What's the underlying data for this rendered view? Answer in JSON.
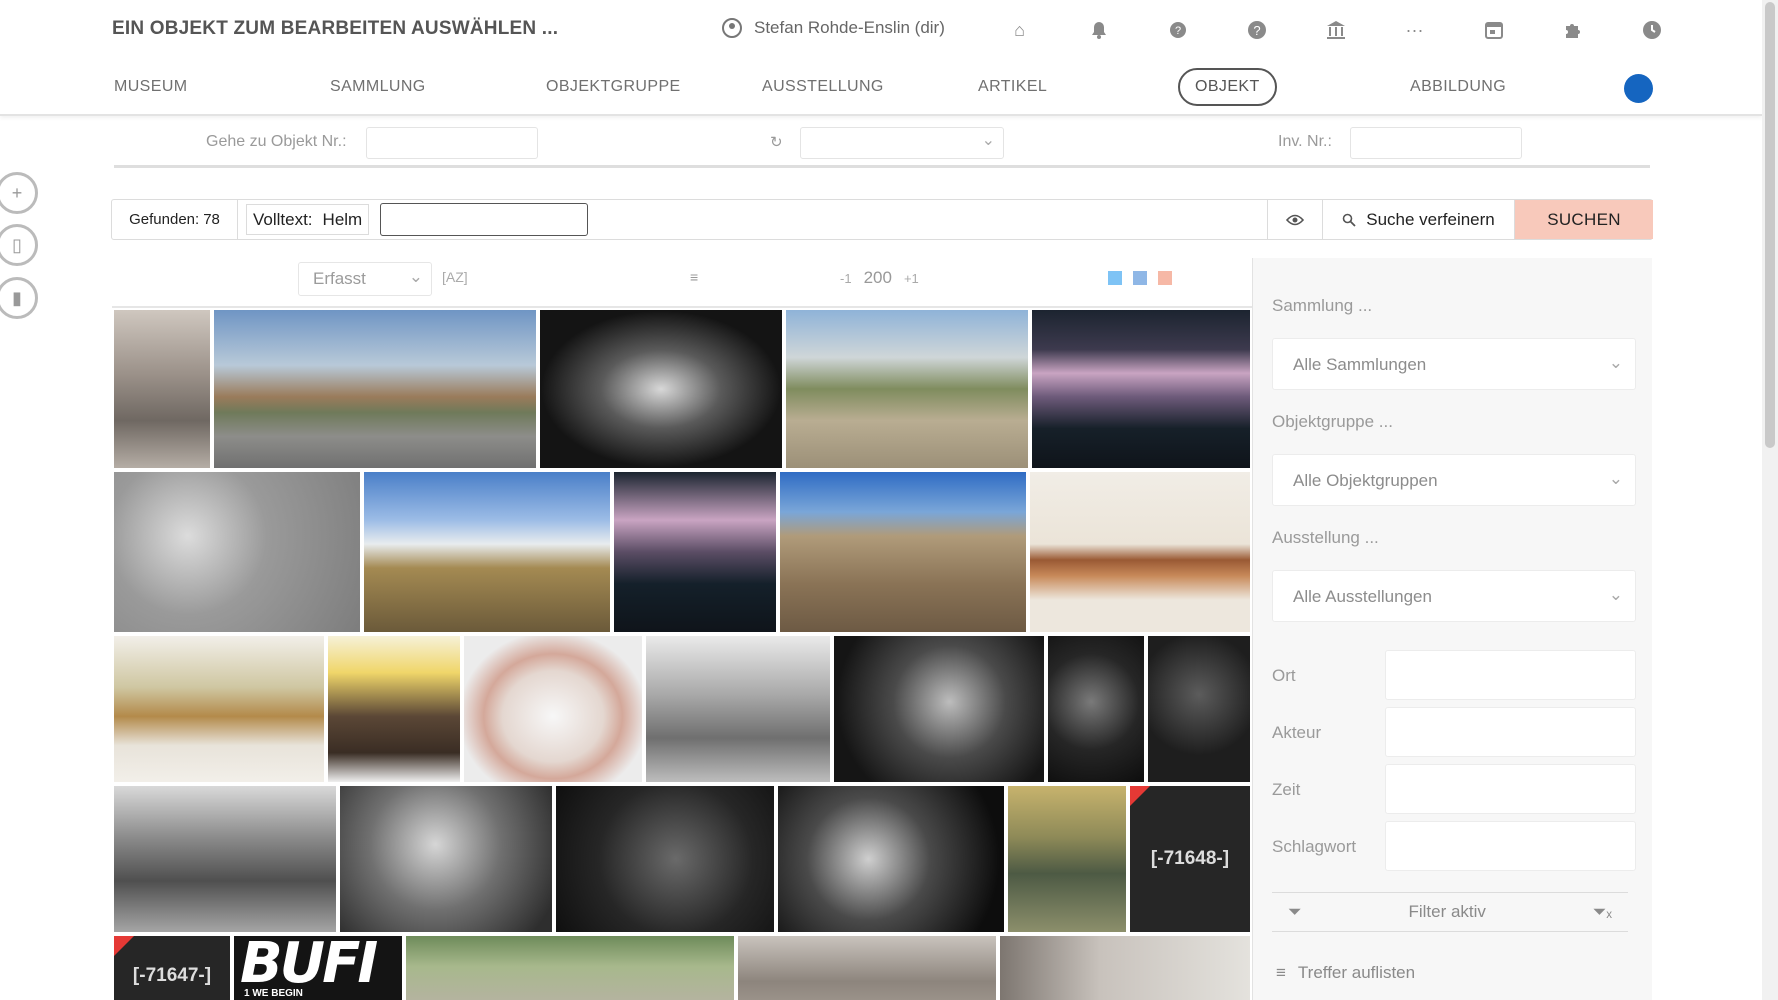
{
  "header": {
    "title": "EIN OBJEKT ZUM BEARBEITEN AUSWÄHLEN ...",
    "user": "Stefan Rohde-Enslin (dir)",
    "icons": [
      "home-icon",
      "bell-icon",
      "help-icon",
      "question-icon",
      "institution-icon",
      "more-icon",
      "calendar-icon",
      "puzzle-icon",
      "clock-icon"
    ]
  },
  "nav": {
    "items": [
      "MUSEUM",
      "SAMMLUNG",
      "OBJEKTGRUPPE",
      "AUSSTELLUNG",
      "ARTIKEL",
      "OBJEKT",
      "ABBILDUNG"
    ],
    "active": "OBJEKT"
  },
  "goto": {
    "object_label": "Gehe zu Objekt Nr.:",
    "inv_label": "Inv. Nr.:",
    "reset_icon": "refresh-icon"
  },
  "search": {
    "found_label": "Gefunden:",
    "found_count": "78",
    "volltext_label": "Volltext:",
    "volltext_value": "Helm",
    "input_value": "",
    "refine_label": "Suche verfeinern",
    "search_label": "SUCHEN"
  },
  "toolbar": {
    "sort_value": "Erfasst",
    "az_label": "[AZ]",
    "minus_label": "-1",
    "page_size": "200",
    "plus_label": "+1",
    "view_colors": [
      "#7ec3f5",
      "#8fb7e6",
      "#f6b8a6"
    ]
  },
  "grid": {
    "placeholders": [
      "[-71648-]",
      "[-71647-]"
    ],
    "logo_text": "BUFI",
    "logo_sub": "1 WE BEGIN"
  },
  "filters": {
    "sammlung_label": "Sammlung ...",
    "sammlung_value": "Alle Sammlungen",
    "objektgruppe_label": "Objektgruppe ...",
    "objektgruppe_value": "Alle Objektgruppen",
    "ausstellung_label": "Ausstellung ...",
    "ausstellung_value": "Alle Ausstellungen",
    "ort_label": "Ort",
    "akteur_label": "Akteur",
    "zeit_label": "Zeit",
    "schlagwort_label": "Schlagwort",
    "filter_status": "Filter aktiv",
    "treffer_label": "Treffer auflisten"
  }
}
